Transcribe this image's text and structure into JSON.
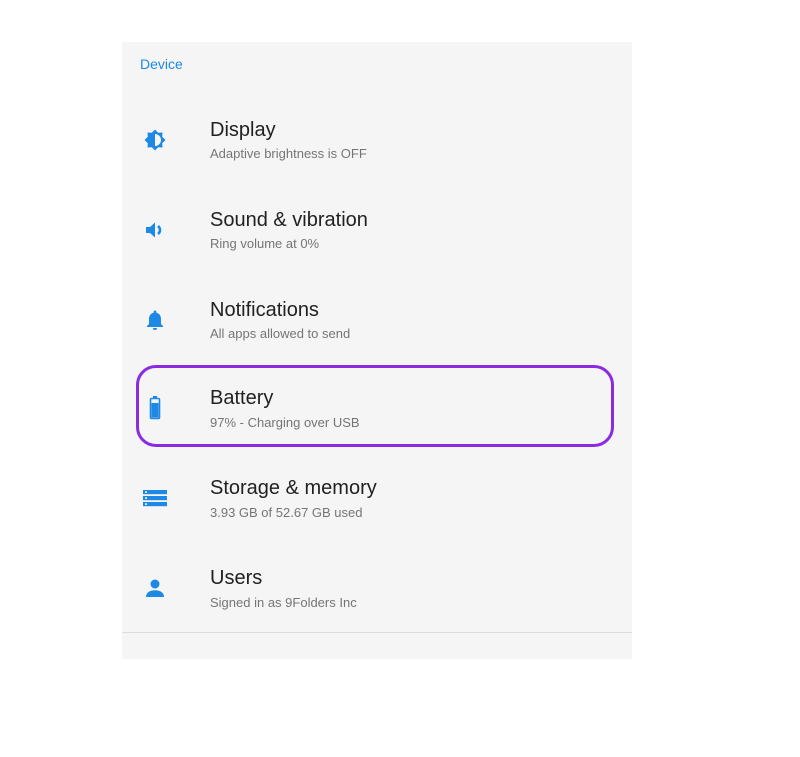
{
  "section": {
    "title": "Device"
  },
  "colors": {
    "accent": "#1e88e5",
    "highlight": "#8a2be2"
  },
  "items": [
    {
      "key": "display",
      "icon": "brightness-icon",
      "title": "Display",
      "subtitle": "Adaptive brightness is OFF"
    },
    {
      "key": "sound",
      "icon": "volume-icon",
      "title": "Sound & vibration",
      "subtitle": "Ring volume at 0%"
    },
    {
      "key": "notifications",
      "icon": "bell-icon",
      "title": "Notifications",
      "subtitle": "All apps allowed to send"
    },
    {
      "key": "battery",
      "icon": "battery-icon",
      "title": "Battery",
      "subtitle": "97% - Charging over USB"
    },
    {
      "key": "storage",
      "icon": "storage-icon",
      "title": "Storage & memory",
      "subtitle": "3.93 GB of 52.67 GB used"
    },
    {
      "key": "users",
      "icon": "person-icon",
      "title": "Users",
      "subtitle": "Signed in as 9Folders Inc"
    }
  ]
}
